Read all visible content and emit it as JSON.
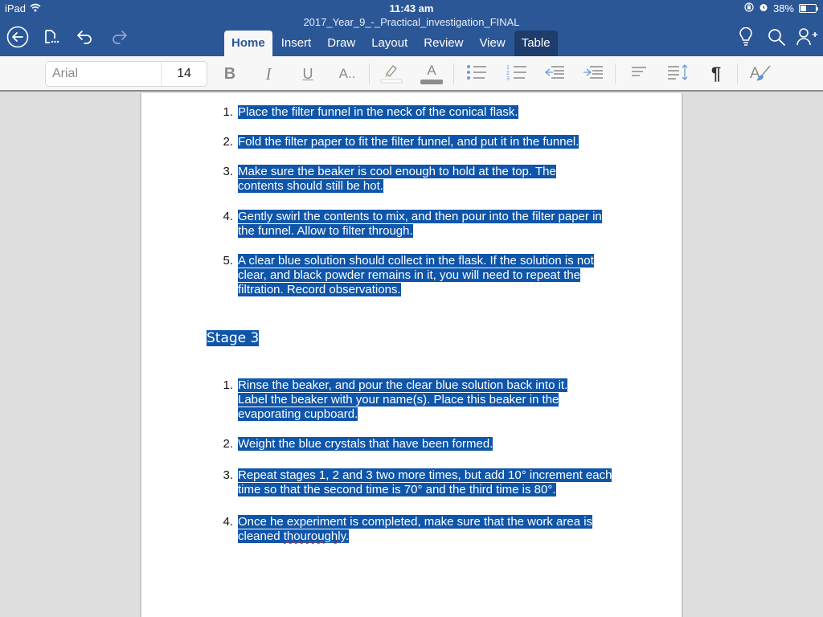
{
  "status_bar": {
    "device": "iPad",
    "time": "11:43 am",
    "battery_percent_label": "38%",
    "battery_level": 0.38
  },
  "document": {
    "title": "2017_Year_9_-_Practical_investigation_FINAL"
  },
  "toolbar": {
    "back_icon": "back-circle-icon",
    "file_icon": "file-menu-icon",
    "undo_icon": "undo-icon",
    "redo_icon": "redo-icon",
    "right_icons": [
      "lightbulb-icon",
      "search-icon",
      "add-person-icon"
    ]
  },
  "tabs": [
    {
      "label": "Home",
      "active": true
    },
    {
      "label": "Insert"
    },
    {
      "label": "Draw"
    },
    {
      "label": "Layout"
    },
    {
      "label": "Review"
    },
    {
      "label": "View"
    },
    {
      "label": "Table"
    }
  ],
  "ribbon": {
    "font_name": "Arial",
    "font_size": "14",
    "bold_glyph": "B",
    "italic_glyph": "I",
    "underline_glyph": "U",
    "font_options_glyph": "A..",
    "font_color_glyph": "A",
    "paragraph_mark_glyph": "¶",
    "styles_glyph": "A"
  },
  "colors": {
    "brand": "#2b5797",
    "selection": "#0f56aa",
    "active_tab_text": "#2b5797",
    "contextual_tab": "#1e3c6c"
  },
  "content": {
    "list_a": [
      {
        "num": "1.",
        "text": "Place the filter funnel in the neck of the conical flask."
      },
      {
        "num": "2.",
        "text": "Fold the filter paper to fit the filter funnel, and put it in the funnel."
      },
      {
        "num": "3.",
        "text": "Make sure the beaker is cool enough to hold at the top. The contents should still be hot."
      },
      {
        "num": "4.",
        "text": "Gently swirl the contents to mix, and then pour into the filter paper in the funnel. Allow to filter through."
      },
      {
        "num": "5.",
        "text": "A clear blue solution should collect in the flask. If the solution is not clear, and black powder remains in it, you will need to repeat the filtration. Record observations."
      }
    ],
    "heading": "Stage 3",
    "list_b": [
      {
        "num": "1.",
        "text": "Rinse the beaker, and pour the clear blue solution back into it. Label the beaker with your name(s). Place this beaker in the evaporating cupboard."
      },
      {
        "num": "2.",
        "text": "Weight the blue crystals that have been formed."
      },
      {
        "num": "3.",
        "text": "Repeat stages 1, 2 and 3 two more times, but add 10° increment each time so that the second time is 70° and the third time is 80°."
      },
      {
        "num": "4.",
        "text_before": "Once he experiment is completed, make sure that the work area is cleaned ",
        "misspelled": "thouroughly",
        "text_after": "."
      }
    ]
  }
}
